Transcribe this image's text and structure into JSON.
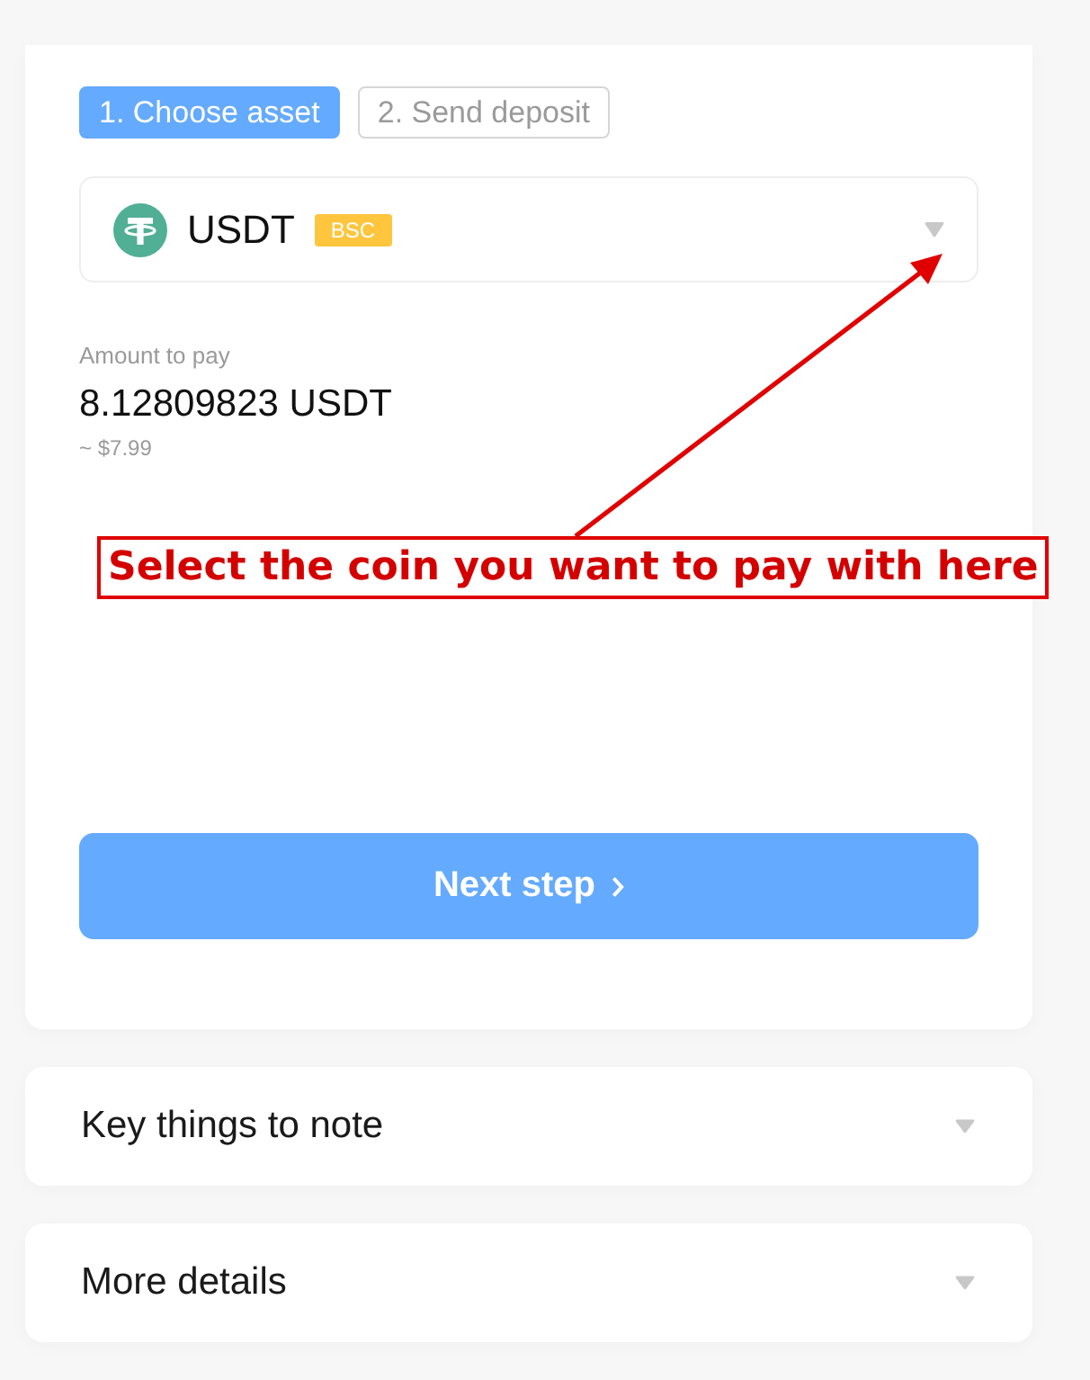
{
  "steps": [
    {
      "label": "1. Choose asset",
      "selected": true
    },
    {
      "label": "2. Send deposit",
      "selected": false
    }
  ],
  "coin_select": {
    "coin": "USDT",
    "network": "BSC"
  },
  "amount": {
    "label": "Amount to pay",
    "value": "8.12809823 USDT",
    "fiat": "~ $7.99"
  },
  "next_button": {
    "label": "Next step"
  },
  "annotation": {
    "text": "Select the coin you want to pay with here"
  },
  "sections": [
    {
      "title": "Key things to note",
      "expanded": false
    },
    {
      "title": "More details",
      "expanded": false
    }
  ]
}
